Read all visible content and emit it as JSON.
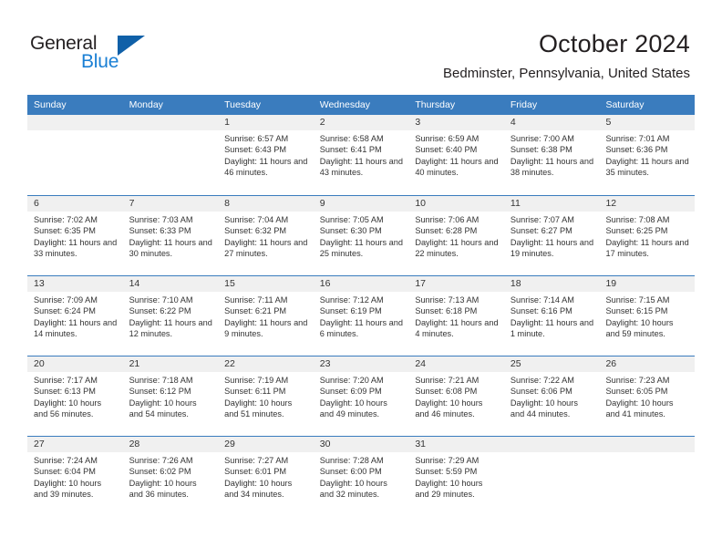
{
  "brand": {
    "name_part1": "General",
    "name_part2": "Blue",
    "accent_color": "#1a7fd4",
    "triangle_color": "#1060a8"
  },
  "header": {
    "title": "October 2024",
    "subtitle": "Bedminster, Pennsylvania, United States",
    "header_bg": "#3a7cbe"
  },
  "weekdays": [
    "Sunday",
    "Monday",
    "Tuesday",
    "Wednesday",
    "Thursday",
    "Friday",
    "Saturday"
  ],
  "weeks": [
    [
      {
        "day": "",
        "sunrise": "",
        "sunset": "",
        "daylight": "",
        "empty": true
      },
      {
        "day": "",
        "sunrise": "",
        "sunset": "",
        "daylight": "",
        "empty": true
      },
      {
        "day": "1",
        "sunrise": "Sunrise: 6:57 AM",
        "sunset": "Sunset: 6:43 PM",
        "daylight": "Daylight: 11 hours and 46 minutes."
      },
      {
        "day": "2",
        "sunrise": "Sunrise: 6:58 AM",
        "sunset": "Sunset: 6:41 PM",
        "daylight": "Daylight: 11 hours and 43 minutes."
      },
      {
        "day": "3",
        "sunrise": "Sunrise: 6:59 AM",
        "sunset": "Sunset: 6:40 PM",
        "daylight": "Daylight: 11 hours and 40 minutes."
      },
      {
        "day": "4",
        "sunrise": "Sunrise: 7:00 AM",
        "sunset": "Sunset: 6:38 PM",
        "daylight": "Daylight: 11 hours and 38 minutes."
      },
      {
        "day": "5",
        "sunrise": "Sunrise: 7:01 AM",
        "sunset": "Sunset: 6:36 PM",
        "daylight": "Daylight: 11 hours and 35 minutes."
      }
    ],
    [
      {
        "day": "6",
        "sunrise": "Sunrise: 7:02 AM",
        "sunset": "Sunset: 6:35 PM",
        "daylight": "Daylight: 11 hours and 33 minutes."
      },
      {
        "day": "7",
        "sunrise": "Sunrise: 7:03 AM",
        "sunset": "Sunset: 6:33 PM",
        "daylight": "Daylight: 11 hours and 30 minutes."
      },
      {
        "day": "8",
        "sunrise": "Sunrise: 7:04 AM",
        "sunset": "Sunset: 6:32 PM",
        "daylight": "Daylight: 11 hours and 27 minutes."
      },
      {
        "day": "9",
        "sunrise": "Sunrise: 7:05 AM",
        "sunset": "Sunset: 6:30 PM",
        "daylight": "Daylight: 11 hours and 25 minutes."
      },
      {
        "day": "10",
        "sunrise": "Sunrise: 7:06 AM",
        "sunset": "Sunset: 6:28 PM",
        "daylight": "Daylight: 11 hours and 22 minutes."
      },
      {
        "day": "11",
        "sunrise": "Sunrise: 7:07 AM",
        "sunset": "Sunset: 6:27 PM",
        "daylight": "Daylight: 11 hours and 19 minutes."
      },
      {
        "day": "12",
        "sunrise": "Sunrise: 7:08 AM",
        "sunset": "Sunset: 6:25 PM",
        "daylight": "Daylight: 11 hours and 17 minutes."
      }
    ],
    [
      {
        "day": "13",
        "sunrise": "Sunrise: 7:09 AM",
        "sunset": "Sunset: 6:24 PM",
        "daylight": "Daylight: 11 hours and 14 minutes."
      },
      {
        "day": "14",
        "sunrise": "Sunrise: 7:10 AM",
        "sunset": "Sunset: 6:22 PM",
        "daylight": "Daylight: 11 hours and 12 minutes."
      },
      {
        "day": "15",
        "sunrise": "Sunrise: 7:11 AM",
        "sunset": "Sunset: 6:21 PM",
        "daylight": "Daylight: 11 hours and 9 minutes."
      },
      {
        "day": "16",
        "sunrise": "Sunrise: 7:12 AM",
        "sunset": "Sunset: 6:19 PM",
        "daylight": "Daylight: 11 hours and 6 minutes."
      },
      {
        "day": "17",
        "sunrise": "Sunrise: 7:13 AM",
        "sunset": "Sunset: 6:18 PM",
        "daylight": "Daylight: 11 hours and 4 minutes."
      },
      {
        "day": "18",
        "sunrise": "Sunrise: 7:14 AM",
        "sunset": "Sunset: 6:16 PM",
        "daylight": "Daylight: 11 hours and 1 minute."
      },
      {
        "day": "19",
        "sunrise": "Sunrise: 7:15 AM",
        "sunset": "Sunset: 6:15 PM",
        "daylight": "Daylight: 10 hours and 59 minutes."
      }
    ],
    [
      {
        "day": "20",
        "sunrise": "Sunrise: 7:17 AM",
        "sunset": "Sunset: 6:13 PM",
        "daylight": "Daylight: 10 hours and 56 minutes."
      },
      {
        "day": "21",
        "sunrise": "Sunrise: 7:18 AM",
        "sunset": "Sunset: 6:12 PM",
        "daylight": "Daylight: 10 hours and 54 minutes."
      },
      {
        "day": "22",
        "sunrise": "Sunrise: 7:19 AM",
        "sunset": "Sunset: 6:11 PM",
        "daylight": "Daylight: 10 hours and 51 minutes."
      },
      {
        "day": "23",
        "sunrise": "Sunrise: 7:20 AM",
        "sunset": "Sunset: 6:09 PM",
        "daylight": "Daylight: 10 hours and 49 minutes."
      },
      {
        "day": "24",
        "sunrise": "Sunrise: 7:21 AM",
        "sunset": "Sunset: 6:08 PM",
        "daylight": "Daylight: 10 hours and 46 minutes."
      },
      {
        "day": "25",
        "sunrise": "Sunrise: 7:22 AM",
        "sunset": "Sunset: 6:06 PM",
        "daylight": "Daylight: 10 hours and 44 minutes."
      },
      {
        "day": "26",
        "sunrise": "Sunrise: 7:23 AM",
        "sunset": "Sunset: 6:05 PM",
        "daylight": "Daylight: 10 hours and 41 minutes."
      }
    ],
    [
      {
        "day": "27",
        "sunrise": "Sunrise: 7:24 AM",
        "sunset": "Sunset: 6:04 PM",
        "daylight": "Daylight: 10 hours and 39 minutes."
      },
      {
        "day": "28",
        "sunrise": "Sunrise: 7:26 AM",
        "sunset": "Sunset: 6:02 PM",
        "daylight": "Daylight: 10 hours and 36 minutes."
      },
      {
        "day": "29",
        "sunrise": "Sunrise: 7:27 AM",
        "sunset": "Sunset: 6:01 PM",
        "daylight": "Daylight: 10 hours and 34 minutes."
      },
      {
        "day": "30",
        "sunrise": "Sunrise: 7:28 AM",
        "sunset": "Sunset: 6:00 PM",
        "daylight": "Daylight: 10 hours and 32 minutes."
      },
      {
        "day": "31",
        "sunrise": "Sunrise: 7:29 AM",
        "sunset": "Sunset: 5:59 PM",
        "daylight": "Daylight: 10 hours and 29 minutes."
      },
      {
        "day": "",
        "sunrise": "",
        "sunset": "",
        "daylight": "",
        "empty": true
      },
      {
        "day": "",
        "sunrise": "",
        "sunset": "",
        "daylight": "",
        "empty": true
      }
    ]
  ]
}
